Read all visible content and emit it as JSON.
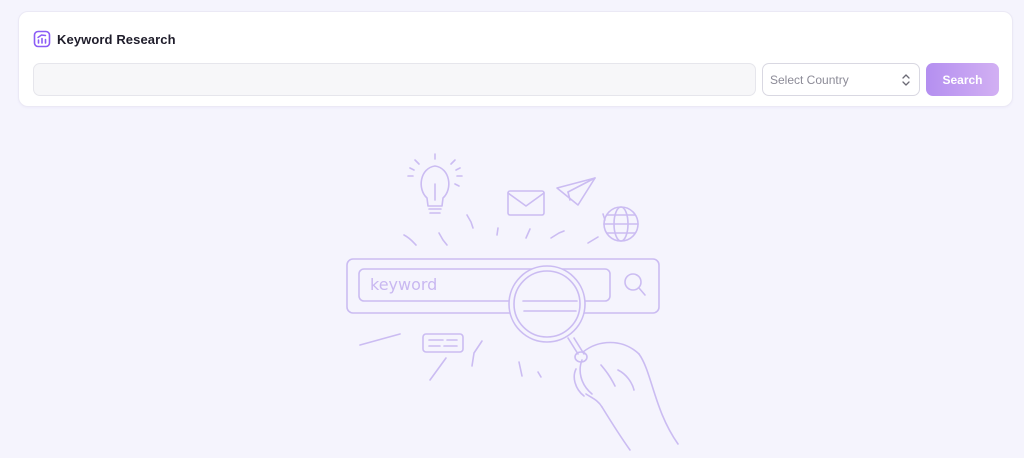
{
  "app": {
    "title": "Keyword Research",
    "title_icon": "chart-icon",
    "accent_color": "#9b6ee8",
    "background_color": "#f5f4fd"
  },
  "search": {
    "keyword_value": "",
    "keyword_placeholder": "",
    "country_placeholder": "Select Country",
    "search_label": "Search"
  },
  "illustration": {
    "search_bar_text": "keyword",
    "icons": [
      "lightbulb-icon",
      "envelope-icon",
      "paper-plane-icon",
      "globe-icon",
      "magnifier-icon",
      "hand-icon"
    ]
  }
}
